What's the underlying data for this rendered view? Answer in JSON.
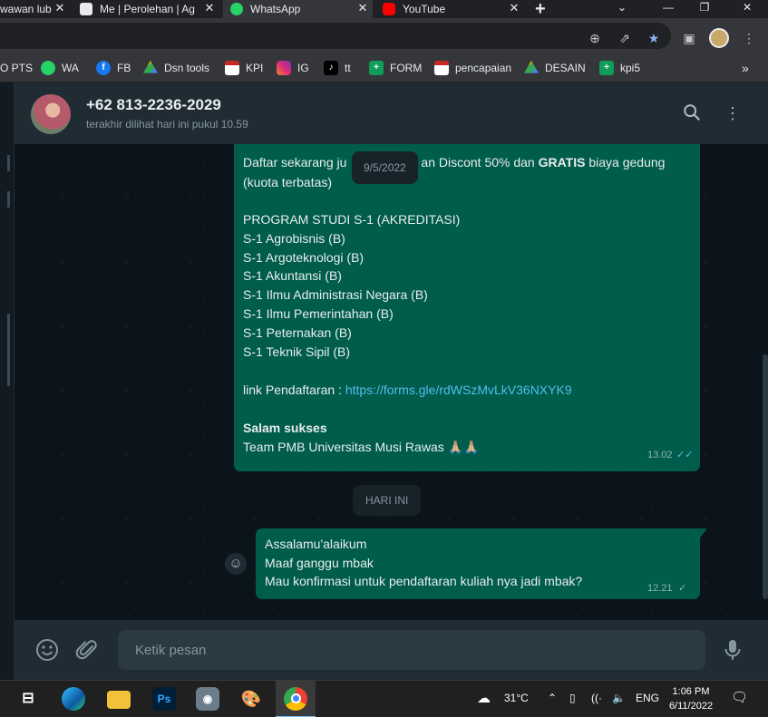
{
  "browser": {
    "tabs": [
      {
        "title": "wawan lub",
        "active": false
      },
      {
        "title": "Me | Perolehan | Ag",
        "active": false
      },
      {
        "title": "WhatsApp",
        "active": true
      },
      {
        "title": "YouTube",
        "active": false
      }
    ],
    "new_tab_label": "+",
    "bookmarks": [
      {
        "label": "O PTS"
      },
      {
        "label": "WA"
      },
      {
        "label": "FB"
      },
      {
        "label": "Dsn tools"
      },
      {
        "label": "KPI"
      },
      {
        "label": "IG"
      },
      {
        "label": "tt"
      },
      {
        "label": "FORM"
      },
      {
        "label": "pencapaian"
      },
      {
        "label": "DESAIN"
      },
      {
        "label": "kpi5"
      }
    ],
    "bookmarks_overflow": "»"
  },
  "chat": {
    "contact_name": "+62 813-2236-2029",
    "contact_status": "terakhir dilihat hari ini pukul 10.59",
    "date_pill": "9/5/2022",
    "today_pill": "HARI INI",
    "message1": {
      "line1_pre": "Daftar sekarang ju",
      "line1_mid": "an Discont 50% dan ",
      "line1_bold": "GRATIS",
      "line1_post": " biaya gedung",
      "line2": "(kuota terbatas)",
      "program_heading": "PROGRAM STUDI S-1 (AKREDITASI)",
      "programs": [
        "S-1 Agrobisnis (B)",
        "S-1 Argoteknologi (B)",
        "S-1 Akuntansi (B)",
        "S-1 Ilmu Administrasi Negara (B)",
        "S-1 Ilmu Pemerintahan (B)",
        "S-1 Peternakan (B)",
        "S-1 Teknik Sipil (B)"
      ],
      "link_label": "link Pendaftaran : ",
      "link_url": "https://forms.gle/rdWSzMvLkV36NXYK9",
      "closing_bold": "Salam sukses",
      "closing_line": "Team PMB Universitas Musi Rawas 🙏🏼🙏🏼",
      "time": "13.02",
      "status": "read"
    },
    "message2": {
      "lines": [
        "Assalamu'alaikum",
        "Maaf ganggu mbak",
        "Mau konfirmasi untuk pendaftaran kuliah nya jadi mbak?"
      ],
      "time": "12.21",
      "status": "sent"
    },
    "composer_placeholder": "Ketik pesan"
  },
  "taskbar": {
    "weather": "31°C",
    "language": "ENG",
    "time": "1:06 PM",
    "date": "6/11/2022"
  },
  "colors": {
    "outgoing_bubble": "#005c4b",
    "link": "#53bdeb",
    "read_tick": "#53bdeb",
    "header_bg": "#202c33",
    "chat_bg": "#0b141a"
  },
  "icons": [
    "search-icon",
    "menu-icon",
    "emoji-icon",
    "attach-icon",
    "mic-icon",
    "double-tick-icon",
    "single-tick-icon",
    "whatsapp-icon",
    "youtube-icon"
  ]
}
